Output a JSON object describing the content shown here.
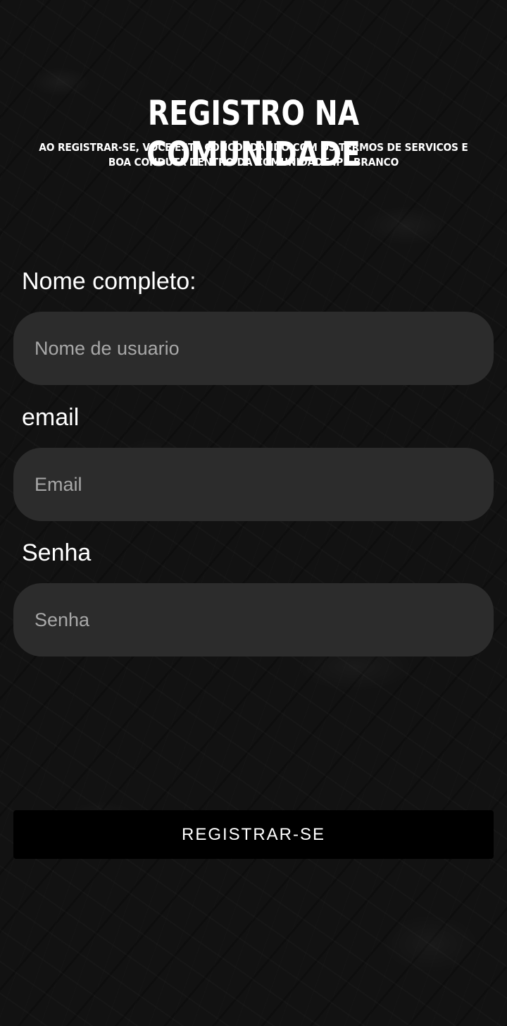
{
  "header": {
    "title": "REGISTRO NA COMUNIDADE",
    "subtitle": "AO REGISTRAR-SE, VOCE ESTA CONCORDANDO COM OS TERMOS DE SERVICOS E BOA CONDUTA DENTRO DA COMUNIDADE IPE-BRANCO"
  },
  "form": {
    "name": {
      "label": "Nome completo:",
      "placeholder": "Nome de usuario",
      "value": ""
    },
    "email": {
      "label": "email",
      "placeholder": "Email",
      "value": ""
    },
    "password": {
      "label": "Senha",
      "placeholder": "Senha",
      "value": ""
    },
    "submit_label": "REGISTRAR-SE"
  },
  "colors": {
    "background": "#121212",
    "field_background": "#2c2c2c",
    "button_background": "#000000",
    "text": "#ffffff",
    "placeholder": "#a8a8a8"
  }
}
